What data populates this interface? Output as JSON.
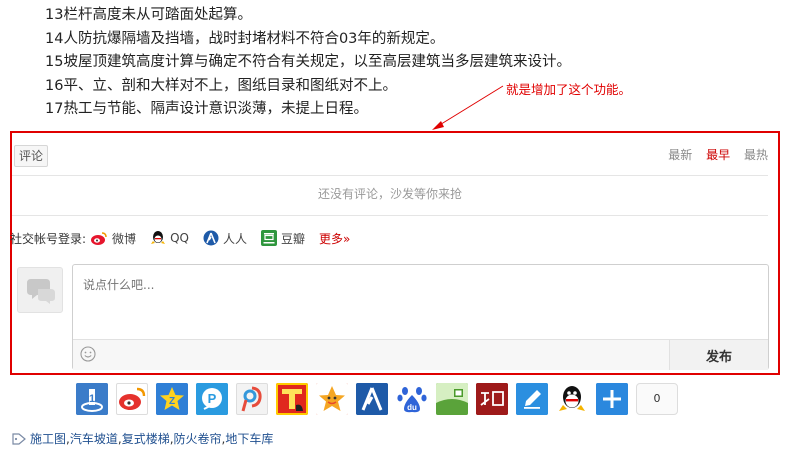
{
  "article": {
    "lines": [
      "13栏杆高度未从可踏面处起算。",
      "14人防抗爆隔墙及挡墙，战时封堵材料不符合03年的新规定。",
      "15坡屋顶建筑高度计算与确定不符合有关规定，以至高层建筑当多层建筑来设计。",
      "16平、立、剖和大样对不上，图纸目录和图纸对不上。",
      "17热工与节能、隔声设计意识淡薄，未提上日程。"
    ]
  },
  "annotation": {
    "text": "就是增加了这个功能。",
    "color": "#e00000"
  },
  "comments": {
    "tab_label": "评论",
    "sort": [
      "最新",
      "最早",
      "最热"
    ],
    "active_sort": "最早",
    "empty_message": "还没有评论，沙发等你来抢",
    "social_login_label": "社交帐号登录:",
    "social": [
      {
        "label": "微博",
        "icon": "weibo-icon"
      },
      {
        "label": "QQ",
        "icon": "qq-icon"
      },
      {
        "label": "人人",
        "icon": "renren-icon"
      },
      {
        "label": "豆瓣",
        "icon": "douban-icon"
      }
    ],
    "more_label": "更多»",
    "input_placeholder": "说点什么吧...",
    "publish_label": "发布"
  },
  "share": {
    "buttons": [
      {
        "icon": "qzone-icon",
        "color": "#3b7cc9"
      },
      {
        "icon": "sina-weibo-icon",
        "color": "#e5322d"
      },
      {
        "icon": "qq-favorites-icon",
        "color": "#2f7fd6"
      },
      {
        "icon": "pengyou-icon",
        "color": "#2a9be0"
      },
      {
        "icon": "tencent-weibo-icon",
        "color": "#e8e8e8"
      },
      {
        "icon": "tianya-icon",
        "color": "#e0281e"
      },
      {
        "icon": "qq-space-star-icon",
        "color": "#e8492a"
      },
      {
        "icon": "renren-icon",
        "color": "#1e5aa8"
      },
      {
        "icon": "baidu-icon",
        "color": "#2f64d8"
      },
      {
        "icon": "kaixin-icon",
        "color": "#5aa33a"
      },
      {
        "icon": "zhihu-icon",
        "color": "#9e1a1a"
      },
      {
        "icon": "note-icon",
        "color": "#2b8fe0"
      },
      {
        "icon": "qq-friend-icon",
        "color": "#3b8fe3"
      },
      {
        "icon": "more-share-icon",
        "color": "#2b88de"
      }
    ],
    "count": "0"
  },
  "tags": [
    "施工图",
    "汽车坡道",
    "复式楼梯",
    "防火卷帘",
    "地下车库"
  ],
  "tag_separator": ", "
}
